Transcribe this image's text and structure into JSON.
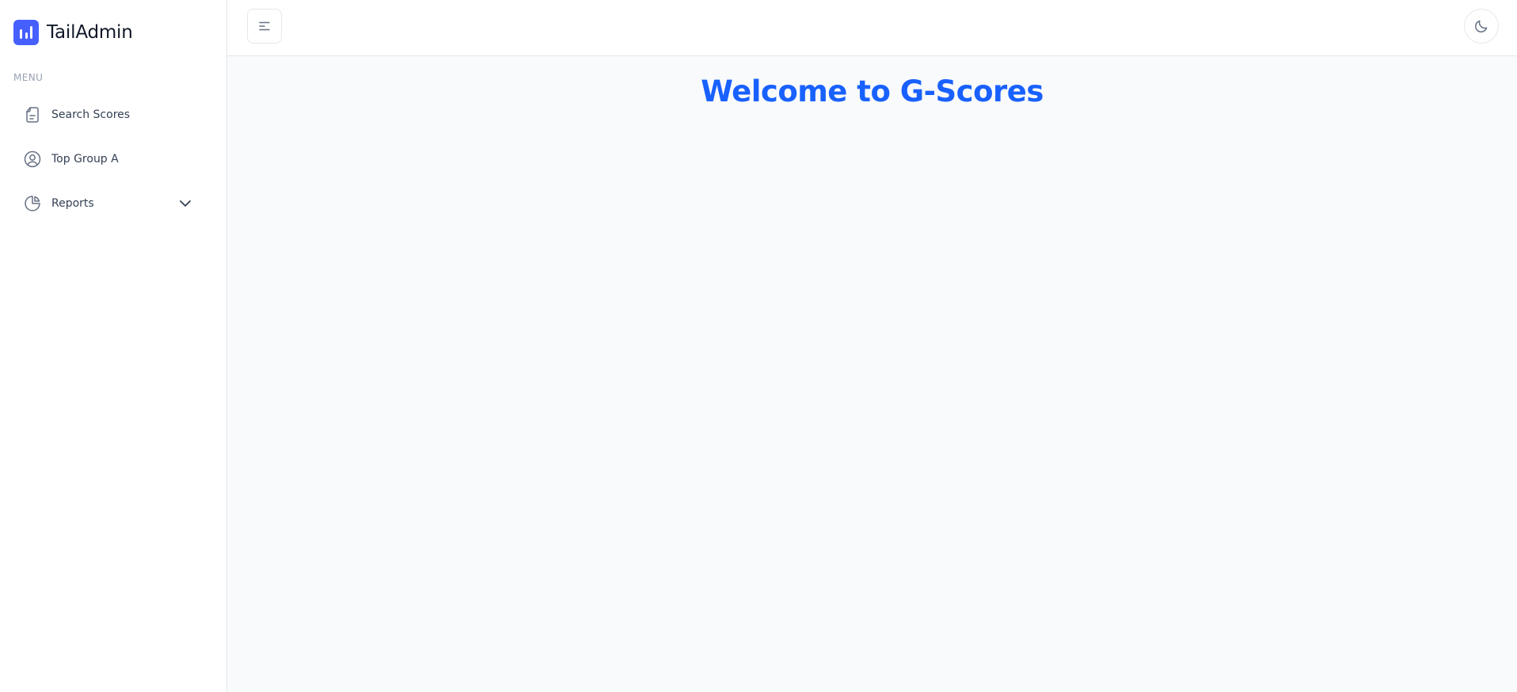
{
  "brand": {
    "name": "TailAdmin",
    "color": "#465fff"
  },
  "sidebar": {
    "menu_heading": "MENU",
    "items": [
      {
        "label": "Search Scores",
        "icon": "document-icon"
      },
      {
        "label": "Top Group A",
        "icon": "user-circle-icon"
      },
      {
        "label": "Reports",
        "icon": "pie-chart-icon",
        "expandable": true
      }
    ]
  },
  "header": {
    "menu_toggle_icon": "hamburger-menu-icon",
    "theme_toggle_icon": "moon-icon"
  },
  "main": {
    "title": "Welcome to G-Scores",
    "title_color": "#1961ff"
  }
}
